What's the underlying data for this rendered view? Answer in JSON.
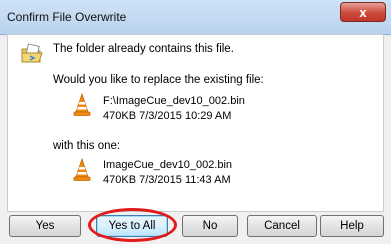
{
  "window": {
    "title": "Confirm File Overwrite",
    "close_label": "x"
  },
  "message": {
    "main": "The folder already contains this file.",
    "question": "Would you like to replace the existing file:",
    "with_label": "with this one:"
  },
  "existing_file": {
    "path": "F:\\ImageCue_dev10_002.bin",
    "details": "470KB  7/3/2015  10:29 AM",
    "icon": "vlc-cone-icon"
  },
  "new_file": {
    "name": "ImageCue_dev10_002.bin",
    "details": "470KB  7/3/2015  11:43 AM",
    "icon": "vlc-cone-icon"
  },
  "buttons": {
    "yes": "Yes",
    "yes_to_all": "Yes to All",
    "no": "No",
    "cancel": "Cancel",
    "help": "Help"
  },
  "colors": {
    "highlight": "#e01b1b",
    "close_button": "#c0382a"
  }
}
